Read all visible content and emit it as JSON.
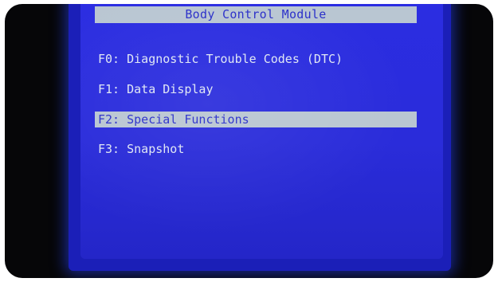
{
  "screen": {
    "title": "Body Control Module",
    "menu": [
      {
        "label": "F0: Diagnostic Trouble Codes (DTC)",
        "selected": false
      },
      {
        "label": "F1: Data Display",
        "selected": false
      },
      {
        "label": "F2: Special Functions",
        "selected": true
      },
      {
        "label": "F3: Snapshot",
        "selected": false
      }
    ]
  },
  "colors": {
    "screen_background": "#2b2de2",
    "highlight_bar": "#b9c6d2",
    "text": "#dfe6f4",
    "highlight_text": "#2a2fc9",
    "bezel": "#060608"
  }
}
